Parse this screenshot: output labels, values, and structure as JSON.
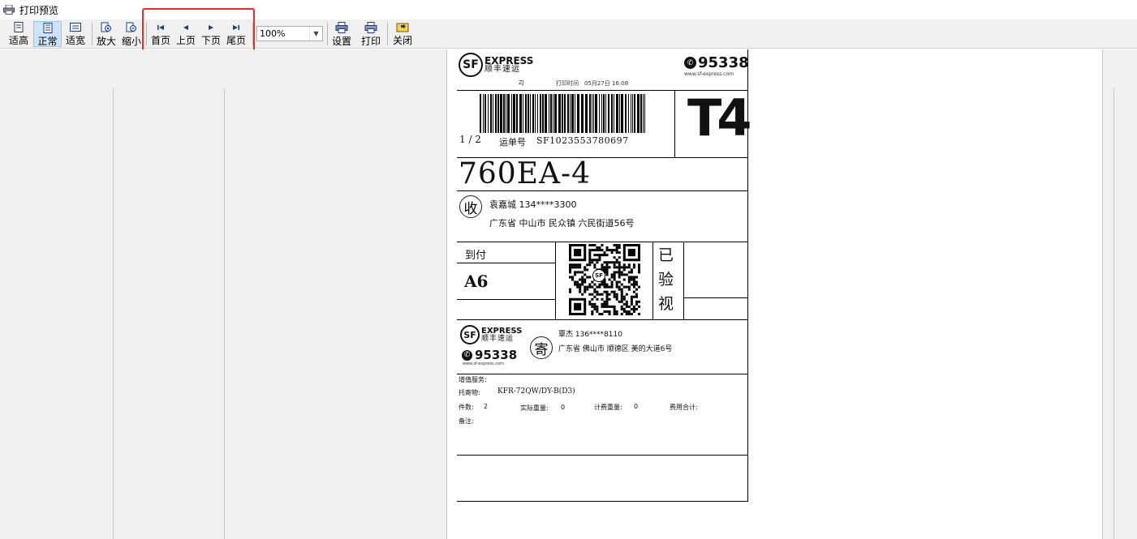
{
  "window": {
    "title": "打印预览"
  },
  "toolbar": {
    "fit_height": "适高",
    "normal": "正常",
    "fit_width": "适宽",
    "zoom_in": "放大",
    "zoom_out": "缩小",
    "first_page": "首页",
    "prev_page": "上页",
    "next_page": "下页",
    "last_page": "尾页",
    "zoom_level": "100%",
    "settings": "设置",
    "print": "打印",
    "close": "关闭"
  },
  "waybill": {
    "brand_en": "EXPRESS",
    "brand_cn": "顺丰速运",
    "logo_text": "SF",
    "hotline": "95338",
    "website": "www.sf-express.com",
    "operator_code": "ZJ",
    "print_time_label": "打印时间",
    "print_time": "05月27日 16:08",
    "page_indicator": "1 / 2",
    "tracking_label": "运单号",
    "tracking_number": "SF1023553780697",
    "service_code": "T4",
    "route_code": "760EA-4",
    "receiver_tag": "收",
    "receiver_name_phone": "袁嘉城  134****3300",
    "receiver_address": "广东省 中山市 民众镇 六民街道56号",
    "payment_method": "到付",
    "zone_code": "A6",
    "qr_center": "SF",
    "inspected_chars": [
      "已",
      "验",
      "视"
    ],
    "sender_tag": "寄",
    "sender_name_phone": "覃杰  136****8110",
    "sender_address": "广东省 佛山市 顺德区 美的大道6号",
    "value_added_label": "增值服务:",
    "goods_label": "托寄物:",
    "goods_value": "KFR-72QW/DY-B(D3)",
    "pieces_label": "件数:",
    "pieces_value": "2",
    "actual_weight_label": "实际重量:",
    "actual_weight_value": "0",
    "billed_weight_label": "计费重量:",
    "billed_weight_value": "0",
    "total_fee_label": "费用合计:",
    "remarks_label": "备注:"
  }
}
